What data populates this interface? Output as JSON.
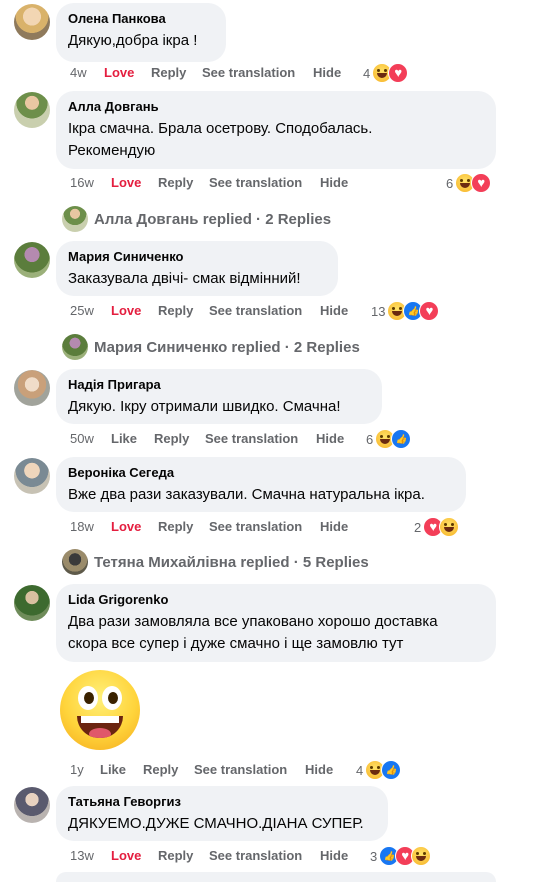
{
  "comments": [
    {
      "author": "Олена Панкова",
      "text": "Дякую,добра ікра !",
      "time": "4w",
      "reaction_label": "Love",
      "reply_label": "Reply",
      "translate_label": "See translation",
      "hide_label": "Hide",
      "reaction_count": "4",
      "reactions": [
        "haha-icon",
        "love-icon"
      ]
    },
    {
      "author": "Алла Довгань",
      "text_lines": [
        "Ікра смачна. Брала осетрову. Сподобалась.",
        "Рекомендую"
      ],
      "time": "16w",
      "reaction_label": "Love",
      "reply_label": "Reply",
      "translate_label": "See translation",
      "hide_label": "Hide",
      "reaction_count": "6",
      "reactions": [
        "haha-icon",
        "love-icon"
      ],
      "replies_label": "Алла Довгань replied · 2 Replies"
    },
    {
      "author": "Мария Синиченко",
      "text": "Заказувала двічі- смак відмінний!",
      "time": "25w",
      "reaction_label": "Love",
      "reply_label": "Reply",
      "translate_label": "See translation",
      "hide_label": "Hide",
      "reaction_count": "13",
      "reactions": [
        "haha-icon",
        "like-icon",
        "love-icon"
      ],
      "replies_label": "Мария Синиченко replied · 2 Replies"
    },
    {
      "author": "Надія Пригара",
      "text": "Дякую. Ікру отримали швидко. Смачна!",
      "time": "50w",
      "reaction_label": "Like",
      "reply_label": "Reply",
      "translate_label": "See translation",
      "hide_label": "Hide",
      "reaction_count": "6",
      "reactions": [
        "haha-icon",
        "like-icon"
      ]
    },
    {
      "author": "Вероніка Сегеда",
      "text": "Вже два рази заказували. Смачна натуральна ікра.",
      "time": "18w",
      "reaction_label": "Love",
      "reply_label": "Reply",
      "translate_label": "See translation",
      "hide_label": "Hide",
      "reaction_count": "2",
      "reactions": [
        "love-icon",
        "haha-icon"
      ],
      "replies_label": "Тетяна Михайлівна replied · 5 Replies"
    },
    {
      "author": "Lida Grigorenko",
      "text_lines": [
        "Два рази замовляла все упаковано хорошо доставка",
        "скора все супер і дуже смачно і ще замовлю тут"
      ],
      "time": "1y",
      "reaction_label": "Like",
      "reply_label": "Reply",
      "translate_label": "See translation",
      "hide_label": "Hide",
      "reaction_count": "4",
      "reactions": [
        "haha-icon",
        "like-icon"
      ],
      "attachment": "grinning-emoji-sticker"
    },
    {
      "author": "Татьяна Геворгиз",
      "text": "ДЯКУЕМО.ДУЖЕ СМАЧНО.ДІАНА СУПЕР.",
      "time": "13w",
      "reaction_label": "Love",
      "reply_label": "Reply",
      "translate_label": "See translation",
      "hide_label": "Hide",
      "reaction_count": "3",
      "reactions": [
        "like-icon",
        "love-icon",
        "haha-icon"
      ]
    }
  ],
  "colors": {
    "bubble": "#f0f2f5",
    "meta_text": "#65676b",
    "love_text": "#e41e3f",
    "like_blue": "#1877f2",
    "love_red": "#f33e58"
  }
}
